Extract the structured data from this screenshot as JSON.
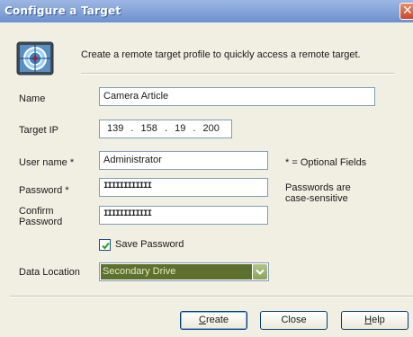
{
  "window": {
    "title": "Configure a Target"
  },
  "intro": "Create a remote target profile to quickly access a remote target.",
  "fields": {
    "name": {
      "label": "Name",
      "value": "Camera Article"
    },
    "target_ip": {
      "label": "Target IP",
      "octets": [
        "139",
        "158",
        "19",
        "200"
      ],
      "separator": "."
    },
    "username": {
      "label": "User name *",
      "value": "Administrator"
    },
    "password": {
      "label": "Password *",
      "value": "IIIIIIIIIIII"
    },
    "confirm_password": {
      "label_line1": "Confirm",
      "label_line2": "Password",
      "value": "IIIIIIIIIIII"
    }
  },
  "notes": {
    "optional": "* = Optional Fields",
    "case_line1": "Passwords are",
    "case_line2": "case-sensitive"
  },
  "save_password": {
    "label": "Save Password",
    "checked": true
  },
  "data_location": {
    "label": "Data Location",
    "selected": "Secondary Drive"
  },
  "buttons": {
    "create": {
      "first": "C",
      "rest": "reate"
    },
    "close": "Close",
    "help": {
      "first": "H",
      "rest": "elp"
    }
  },
  "icons": [
    "target-icon",
    "close-icon",
    "checkmark-icon",
    "chevron-down-icon"
  ],
  "colors": {
    "titlebar": "#7a9bd6",
    "client_bg": "#f1efe2",
    "select_highlight": "#5e702e",
    "close_button": "#d45c3c"
  }
}
